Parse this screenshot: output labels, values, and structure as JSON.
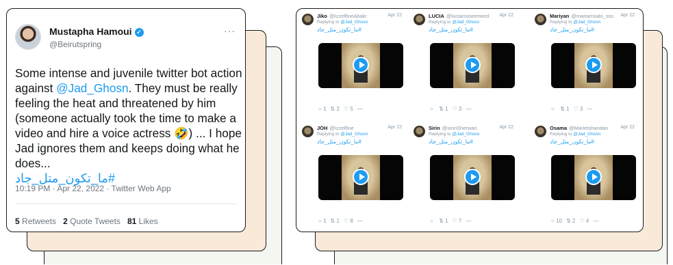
{
  "tweet": {
    "author_name": "Mustapha Hamoui",
    "author_handle": "@Beirutspring",
    "more": "···",
    "text_before": "Some intense and juvenile twitter bot action against ",
    "mention": "@Jad_Ghosn",
    "text_after": ". They must be really feeling the heat and threatened by him (someone actually took the time to make a video and hire a voice actress 🤣) ... I hope Jad ignores them and keeps doing what he does...",
    "hashtag": "#ما_تكون_متل_جاد",
    "timestamp": "10:19 PM · Apr 22, 2022 · Twitter Web App",
    "retweets_count": "5",
    "retweets_label": "Retweets",
    "quotes_count": "2",
    "quotes_label": "Quote Tweets",
    "likes_count": "81",
    "likes_label": "Likes"
  },
  "replies": [
    {
      "name": "Jiko",
      "handle": "@IzzelfineAbakr",
      "date": "Apr 22",
      "replying_prefix": "Replying to",
      "replying_to": "@Jad_Ghosn",
      "hashtag": "#ما_تكون_متل_جاد",
      "reply": "1",
      "retweet": "2",
      "like": "5"
    },
    {
      "name": "LUCIA",
      "handle": "@luciamoseeneed",
      "date": "Apr 22",
      "replying_prefix": "Replying to",
      "replying_to": "@Jad_Ghosn",
      "hashtag": "#ما_تكون_متل_جاد",
      "reply": "",
      "retweet": "1",
      "like": "3"
    },
    {
      "name": "Mariyan",
      "handle": "@mariamsalo_sss",
      "date": "Apr 22",
      "replying_prefix": "Replying to",
      "replying_to": "@Jad_Ghosn",
      "hashtag": "#ما_تكون_متل_جاد",
      "reply": "",
      "retweet": "1",
      "like": "3"
    },
    {
      "name": "JOH",
      "handle": "@Izzelfine",
      "date": "Apr 22",
      "replying_prefix": "Replying to",
      "replying_to": "@Jad_Ghosn",
      "hashtag": "#ما_تكون_متل_جاد",
      "reply": "1",
      "retweet": "1",
      "like": "8"
    },
    {
      "name": "Sirin",
      "handle": "@sirinSherwan",
      "date": "Apr 22",
      "replying_prefix": "Replying to",
      "replying_to": "@Jad_Ghosn",
      "hashtag": "#ما_تكون_متل_جاد",
      "reply": "",
      "retweet": "1",
      "like": "7"
    },
    {
      "name": "Osama",
      "handle": "@Marietshandan",
      "date": "Apr 22",
      "replying_prefix": "Replying to",
      "replying_to": "@Jad_Ghosn",
      "hashtag": "#ما_تكون_متل_جاد",
      "reply": "10",
      "retweet": "2",
      "like": "4"
    }
  ],
  "colors": {
    "accent": "#1d9bf0",
    "cream": "#f8e9d9",
    "mint": "#f4f6f1"
  }
}
